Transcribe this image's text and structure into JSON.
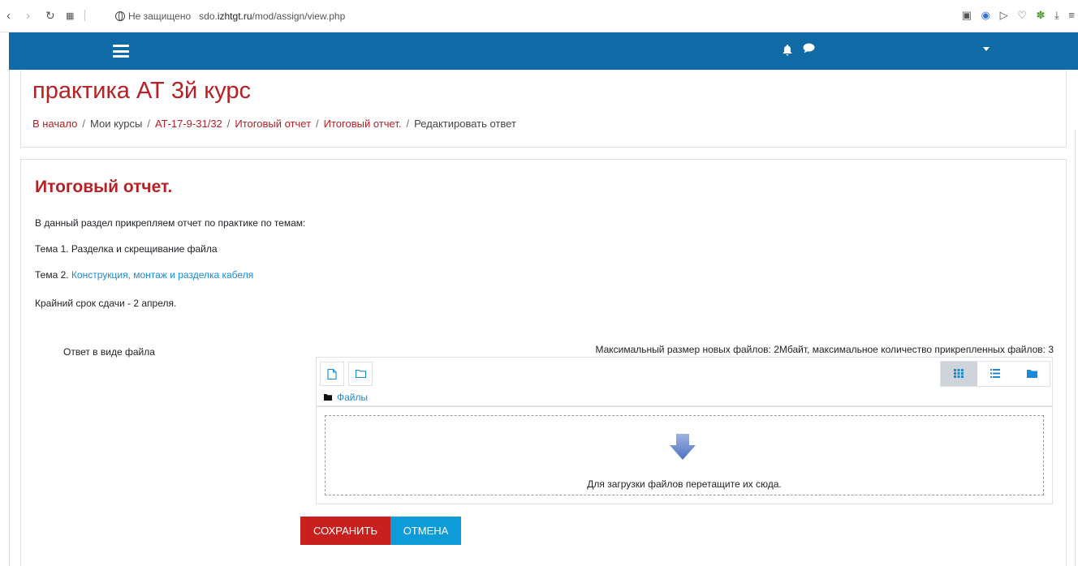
{
  "browser": {
    "back_icon": "chevron-left-icon",
    "forward_icon": "chevron-right-icon",
    "reload_icon": "reload-icon",
    "apps_icon": "grid-icon",
    "security_text": "Не защищено",
    "url_prefix": "sdo.",
    "url_host": "izhtgt.ru",
    "url_path": "/mod/assign/view.php"
  },
  "navbar": {
    "bg_color": "#0f6aa5",
    "menu_icon": "hamburger-icon",
    "notifications_icon": "bell-icon",
    "messages_icon": "chat-icon",
    "user_menu_icon": "caret-down-icon"
  },
  "header": {
    "course_title": "практика АТ 3й курс",
    "breadcrumb": [
      {
        "label": "В начало",
        "link": true
      },
      {
        "label": "Мои курсы",
        "link": false
      },
      {
        "label": "АТ-17-9-31/32",
        "link": true
      },
      {
        "label": "Итоговый отчет",
        "link": true
      },
      {
        "label": "Итоговый отчет.",
        "link": true
      },
      {
        "label": "Редактировать ответ",
        "link": false
      }
    ],
    "separator": "/"
  },
  "assignment": {
    "title": "Итоговый отчет.",
    "intro_line1": "В данный раздел прикрепляем отчет по практике по темам:",
    "intro_line2": "Тема 1. Разделка и скрещивание файла",
    "intro_line3_prefix": "Тема 2. ",
    "intro_line3_link": "Конструкция, монтаж и разделка кабеля",
    "intro_line4": "Крайний срок сдачи - 2 апреля."
  },
  "file_submission": {
    "label": "Ответ в виде файла",
    "limits_text": "Максимальный размер новых файлов: 2Мбайт, максимальное количество прикрепленных файлов: 3",
    "path_label": "Файлы",
    "drop_text": "Для загрузки файлов перетащите их сюда.",
    "active_view": "icons"
  },
  "actions": {
    "save_label": "Сохранить",
    "cancel_label": "Отмена"
  },
  "colors": {
    "accent_red": "#b72025",
    "link_blue": "#1a8ad8",
    "save_bg": "#c8201f",
    "cancel_bg": "#0f9bd8"
  }
}
